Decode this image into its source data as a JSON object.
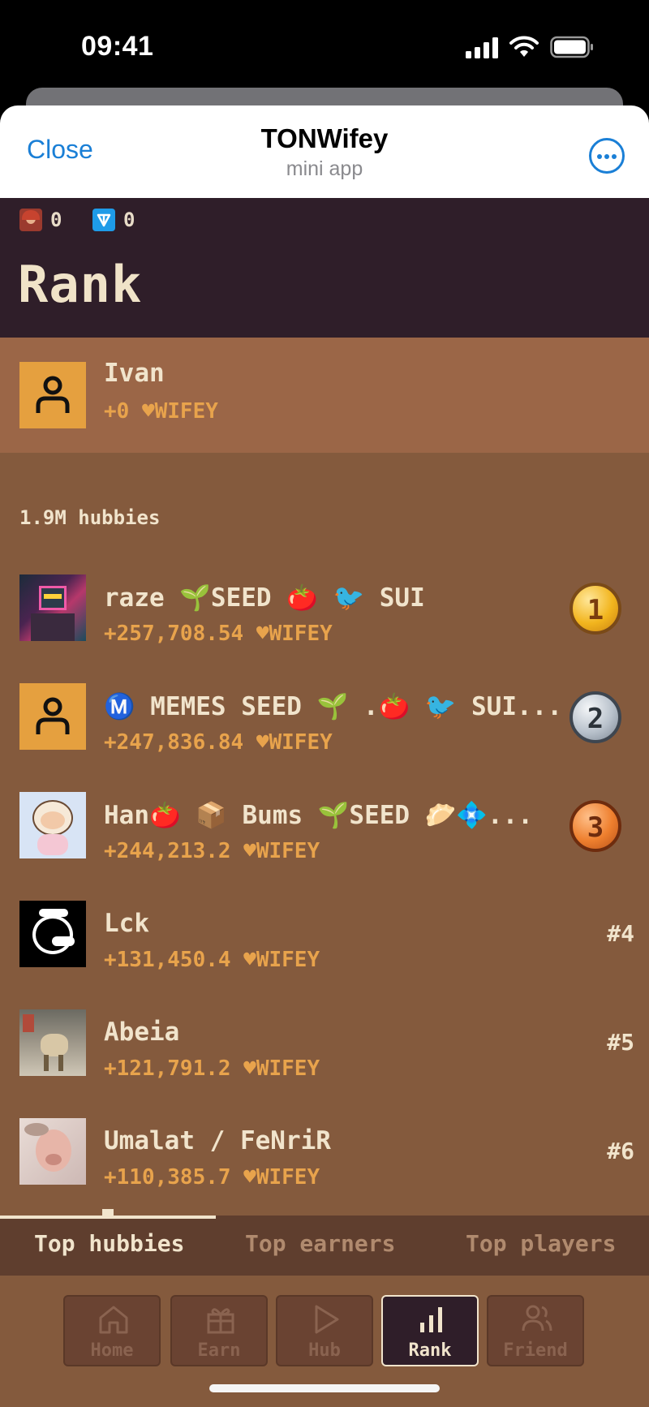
{
  "status_bar": {
    "time": "09:41"
  },
  "telegram": {
    "close_label": "Close",
    "title": "TONWifey",
    "subtitle": "mini app",
    "more_icon": "more-dots-icon"
  },
  "balances": {
    "wifey_balance": "0",
    "ton_balance": "0"
  },
  "page": {
    "title": "Rank"
  },
  "me": {
    "name": "Ivan",
    "score": "+0 ♥WIFEY"
  },
  "leaderboard": {
    "count_label": "1.9M hubbies",
    "rows": [
      {
        "name": "raze 🌱SEED 🍅 🐦 SUI",
        "score": "+257,708.54 ♥WIFEY",
        "rank": "1",
        "medal": "gold"
      },
      {
        "name": "Ⓜ️ MEMES SEED 🌱 .🍅 🐦 SUI...",
        "score": "+247,836.84 ♥WIFEY",
        "rank": "2",
        "medal": "silver"
      },
      {
        "name": "Han🍅 📦 Bums 🌱SEED 🥟💠...",
        "score": "+244,213.2 ♥WIFEY",
        "rank": "3",
        "medal": "bronze"
      },
      {
        "name": "Lck",
        "score": "+131,450.4 ♥WIFEY",
        "rank": "#4"
      },
      {
        "name": "Abeia",
        "score": "+121,791.2 ♥WIFEY",
        "rank": "#5"
      },
      {
        "name": "Umalat / FeNriR",
        "score": "+110,385.7 ♥WIFEY",
        "rank": "#6"
      }
    ]
  },
  "tabs": [
    {
      "label": "Top hubbies",
      "active": true
    },
    {
      "label": "Top earners",
      "active": false
    },
    {
      "label": "Top players",
      "active": false
    }
  ],
  "nav": [
    {
      "label": "Home",
      "icon": "home-icon"
    },
    {
      "label": "Earn",
      "icon": "gift-icon"
    },
    {
      "label": "Hub",
      "icon": "play-icon"
    },
    {
      "label": "Rank",
      "icon": "bar-chart-icon",
      "active": true
    },
    {
      "label": "Friend",
      "icon": "friends-icon"
    }
  ],
  "colors": {
    "accent": "#1a7fd6",
    "header_bg": "#2f1e29",
    "body_bg": "#845a3d",
    "score": "#e8a34c",
    "placeholder_avatar": "#e5a03f"
  }
}
